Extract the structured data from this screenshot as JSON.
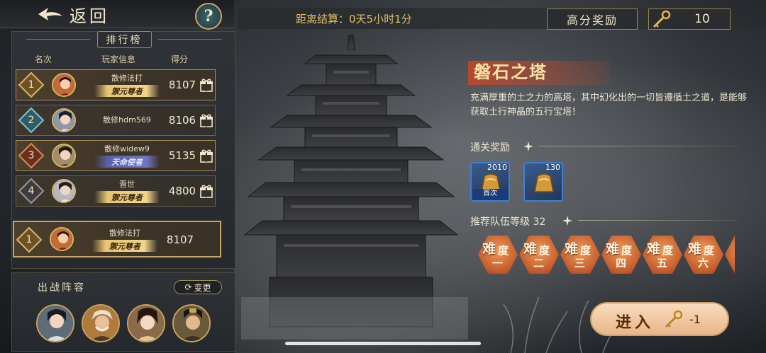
{
  "header": {
    "back_label": "返回",
    "help_label": "?",
    "countdown": "距离结算：0天5小时1分",
    "high_score_reward": "高分奖励",
    "key_count": "10"
  },
  "ranking": {
    "title": "排行榜",
    "columns": [
      "名次",
      "玩家信息",
      "得分"
    ],
    "rows": [
      {
        "rank": "1",
        "name": "散修法打",
        "title": "禦元尊者",
        "score": "8107"
      },
      {
        "rank": "2",
        "name": "散修hdm569",
        "title": "",
        "score": "8106"
      },
      {
        "rank": "3",
        "name": "散修widew9",
        "title": "天命使者",
        "score": "5135"
      },
      {
        "rank": "4",
        "name": "晋世",
        "title": "禦元尊者",
        "score": "4800"
      }
    ],
    "self": {
      "rank": "1",
      "name": "散修法打",
      "title": "禦元尊者",
      "score": "8107"
    }
  },
  "formation": {
    "title": "出战阵容",
    "change_label": "变更"
  },
  "tower": {
    "name": "磐石之塔",
    "description": "充满厚重的土之力的高塔，其中幻化出的一切皆遵循土之道，是能够获取土行神晶的五行宝塔！",
    "clear_reward_label": "通关奖励",
    "rewards": [
      {
        "qty": "2010",
        "tag": "首次"
      },
      {
        "qty": "130",
        "tag": ""
      }
    ],
    "recommend_label": "推荐队伍等级 32",
    "difficulties": [
      {
        "a": "难",
        "b": "度",
        "c": "一"
      },
      {
        "a": "难",
        "b": "度",
        "c": "二"
      },
      {
        "a": "难",
        "b": "度",
        "c": "三"
      },
      {
        "a": "难",
        "b": "度",
        "c": "四"
      },
      {
        "a": "难",
        "b": "度",
        "c": "五"
      },
      {
        "a": "难",
        "b": "度",
        "c": "六"
      }
    ]
  },
  "enter": {
    "label": "进入",
    "cost": "-1"
  },
  "colors": {
    "gold": "#c5a662",
    "accent_orange": "#c25a2a",
    "reward_blue": "#3f7fd0"
  }
}
